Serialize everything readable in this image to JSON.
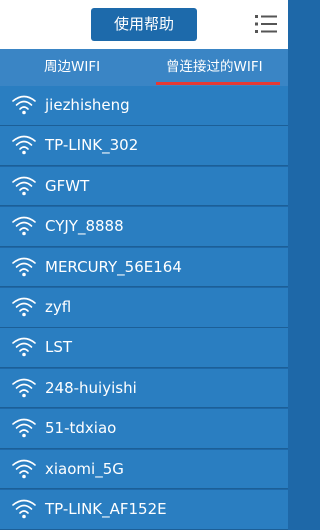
{
  "header": {
    "help_button": "使用帮助",
    "menu_icon": "list-menu-icon"
  },
  "tabs": [
    {
      "label": "周边WIFI",
      "active": false
    },
    {
      "label": "曾连接过的WIFI",
      "active": true
    }
  ],
  "colors": {
    "accent": "#1d6aab",
    "tab_bg": "#3a85c5",
    "row_bg": "#2a7ec1",
    "active_tab_indicator": "#e53935"
  },
  "networks": [
    {
      "name": "jiezhisheng",
      "icon": "wifi-icon"
    },
    {
      "name": "TP-LINK_302",
      "icon": "wifi-icon"
    },
    {
      "name": "GFWT",
      "icon": "wifi-icon"
    },
    {
      "name": "CYJY_8888",
      "icon": "wifi-icon"
    },
    {
      "name": "MERCURY_56E164",
      "icon": "wifi-icon"
    },
    {
      "name": "zyfl",
      "icon": "wifi-icon"
    },
    {
      "name": "LST",
      "icon": "wifi-icon"
    },
    {
      "name": "248-huiyishi",
      "icon": "wifi-icon"
    },
    {
      "name": "51-tdxiao",
      "icon": "wifi-icon"
    },
    {
      "name": "xiaomi_5G",
      "icon": "wifi-icon"
    },
    {
      "name": "TP-LINK_AF152E",
      "icon": "wifi-icon"
    }
  ]
}
